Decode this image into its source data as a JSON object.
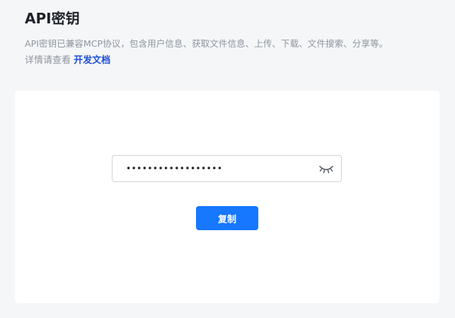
{
  "page": {
    "title": "API密钥",
    "description_line1": "API密钥已兼容MCP协议，包含用户信息、获取文件信息、上传、下载、文件搜索、分享等。",
    "description_line2_prefix": "详情请查看 ",
    "doc_link_label": "开发文档"
  },
  "api_key": {
    "masked_value": "••••••••••••••••••",
    "visibility_icon": "eye-closed-icon"
  },
  "actions": {
    "copy_label": "复制"
  },
  "colors": {
    "primary": "#1677ff",
    "link": "#1d4fd8",
    "background": "#f5f6f8",
    "card": "#ffffff",
    "muted_text": "#8f959e",
    "title_text": "#1f2329"
  }
}
